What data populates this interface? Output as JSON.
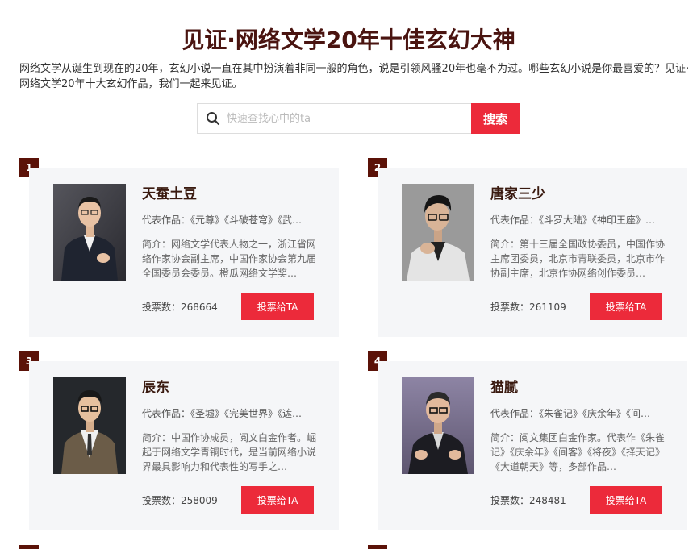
{
  "page": {
    "title": "见证·网络文学20年十佳玄幻大神",
    "intro": "网络文学从诞生到现在的20年，玄幻小说一直在其中扮演着非同一般的角色，说是引领风骚20年也毫不为过。哪些玄幻小说是你最喜爱的？见证·网络文学20年十大玄幻作品，我们一起来见证。"
  },
  "search": {
    "placeholder": "快速查找心中的ta",
    "button_label": "搜索",
    "icon": "search-icon"
  },
  "authors": [
    {
      "rank": "1",
      "name": "天蚕土豆",
      "works": "代表作品：《元尊》《斗破苍穹》《武…",
      "bio": "简介：网络文学代表人物之一，浙江省网络作家协会副主席，中国作家协会第九届全国委员会委员。橙瓜网络文学奖…",
      "votes": "投票数：268664",
      "vote_label": "投票给TA",
      "avatar": {
        "bg": "#3a3a40",
        "suit": "#1f2430",
        "skin": "#e8c2a4"
      }
    },
    {
      "rank": "2",
      "name": "唐家三少",
      "works": "代表作品：《斗罗大陆》《神印王座》…",
      "bio": "简介：第十三届全国政协委员，中国作协主席团委员，北京市青联委员，北京市作协副主席，北京作协网络创作委员…",
      "votes": "投票数：261109",
      "vote_label": "投票给TA",
      "avatar": {
        "bg": "#9a9a9a",
        "suit": "#e4e4e4",
        "skin": "#d9b497"
      }
    },
    {
      "rank": "3",
      "name": "辰东",
      "works": "代表作品：《圣墟》《完美世界》《遮…",
      "bio": "简介：中国作协成员，阅文白金作者。崛起于网络文学青铜时代，是当前网络小说界最具影响力和代表性的写手之…",
      "votes": "投票数：258009",
      "vote_label": "投票给TA",
      "avatar": {
        "bg": "#25282c",
        "suit": "#6b5c48",
        "skin": "#e6c09e"
      }
    },
    {
      "rank": "4",
      "name": "猫腻",
      "works": "代表作品：《朱雀记》《庆余年》《间…",
      "bio": "简介：阅文集团白金作家。代表作《朱雀记》《庆余年》《间客》《将夜》《择天记》《大道朝天》等，多部作品…",
      "votes": "投票数：248481",
      "vote_label": "投票给TA",
      "avatar": {
        "bg": "#7a6e8e",
        "suit": "#1c1c22",
        "skin": "#e2b99c"
      }
    }
  ],
  "next_ranks": [
    "",
    ""
  ]
}
